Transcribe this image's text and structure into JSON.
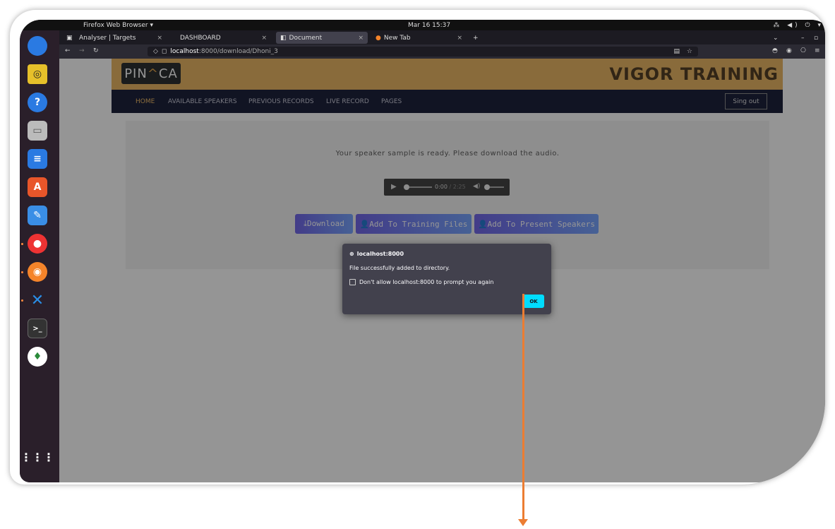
{
  "os": {
    "app_menu": "Firefox Web Browser ▾",
    "clock": "Mar 16  15:37",
    "tray": "⁂ ◀) ⏻ ▾"
  },
  "browser": {
    "tabs": [
      {
        "label": "Analyser | Targets"
      },
      {
        "label": "DASHBOARD"
      },
      {
        "label": "Document"
      },
      {
        "label": "New Tab"
      }
    ],
    "new_tab": "+",
    "url_host": "localhost",
    "url_path": ":8000/download/Dhoni_3"
  },
  "site": {
    "logo_left": "PIN",
    "logo_caret": "^",
    "logo_right": "CA",
    "brand": "VIGOR TRAINING",
    "nav": [
      "HOME",
      "AVAILABLE SPEAKERS",
      "PREVIOUS RECORDS",
      "LIVE RECORD",
      "PAGES"
    ],
    "signout": "Sing out"
  },
  "content": {
    "message": "Your speaker sample is ready. Please download the audio.",
    "audio_current": "0:00",
    "audio_duration": " / 2:25",
    "buttons": [
      "⤓Download",
      "👤Add To Training Files",
      "👤Add To Present Speakers"
    ]
  },
  "dialog": {
    "title": "localhost:8000",
    "message": "File successfully added to directory.",
    "checkbox_label": "Don't allow localhost:8000 to prompt you again",
    "ok_label": "OK"
  },
  "colors": {
    "accent_header": "#e9b35c",
    "nav_bg": "#0f1530",
    "ok_button": "#00ddff",
    "annotation_arrow": "#ec7d32"
  }
}
